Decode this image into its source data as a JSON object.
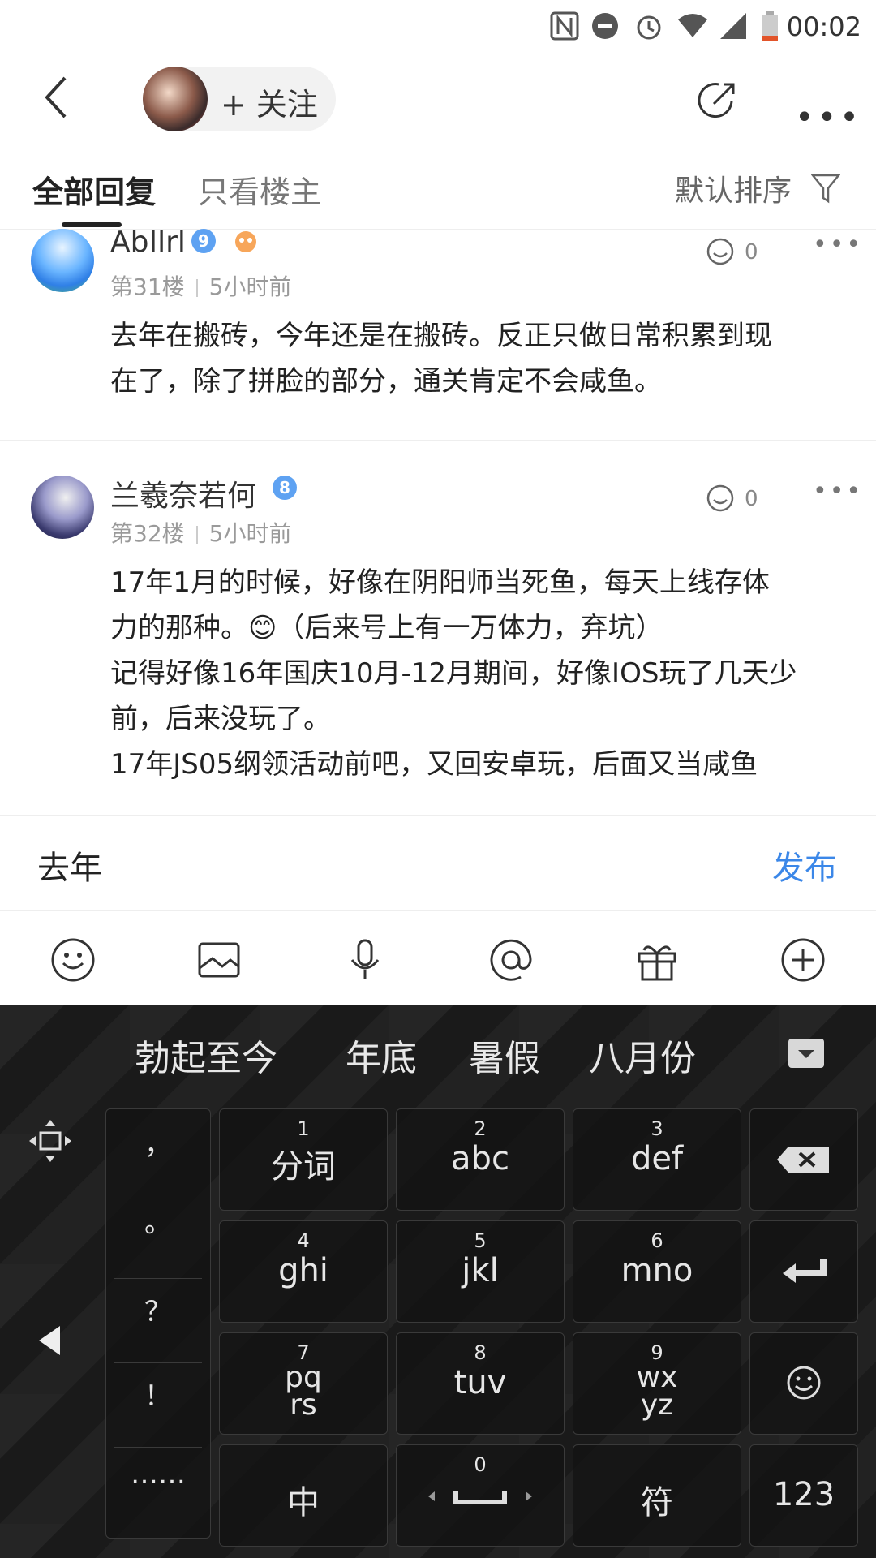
{
  "status_bar": {
    "time": "00:02"
  },
  "header": {
    "follow_label": "+ 关注"
  },
  "tabs": {
    "all": "全部回复",
    "owner_only": "只看楼主",
    "sort": "默认排序"
  },
  "posts": [
    {
      "username": "AbIlrl",
      "level": "9",
      "floor": "第31楼",
      "time": "5小时前",
      "likes": "0",
      "content_lines": [
        "去年在搬砖，今年还是在搬砖。反正只做日常积累到现",
        "在了，除了拼脸的部分，通关肯定不会咸鱼。"
      ]
    },
    {
      "username": "兰羲奈若何",
      "level": "8",
      "floor": "第32楼",
      "time": "5小时前",
      "likes": "0",
      "content_lines": [
        "17年1月的时候，好像在阴阳师当死鱼，每天上线存体",
        "力的那种。😊（后来号上有一万体力，弃坑）",
        "记得好像16年国庆10月-12月期间，好像IOS玩了几天少",
        "前，后来没玩了。",
        "17年JS05纲领活动前吧，又回安卓玩，后面又当咸鱼"
      ]
    }
  ],
  "input": {
    "value": "去年",
    "publish_label": "发布"
  },
  "toolbar": {
    "icons": [
      "emoji-icon",
      "image-icon",
      "mic-icon",
      "at-icon",
      "gift-icon",
      "plus-icon"
    ]
  },
  "keyboard": {
    "candidates": [
      "勃起至今",
      "年底",
      "暑假",
      "八月份"
    ],
    "punctuation": [
      "，",
      "。",
      "？",
      "！",
      "……"
    ],
    "keys": [
      {
        "num": "1",
        "label": "分词"
      },
      {
        "num": "2",
        "label": "abc"
      },
      {
        "num": "3",
        "label": "def"
      },
      {
        "num": "4",
        "label": "ghi"
      },
      {
        "num": "5",
        "label": "jkl"
      },
      {
        "num": "6",
        "label": "mno"
      },
      {
        "num": "7",
        "label": "pqrs"
      },
      {
        "num": "8",
        "label": "tuv"
      },
      {
        "num": "9",
        "label": "wxyz"
      }
    ],
    "bottom_row": {
      "zh": "中",
      "space_num": "0",
      "symbols": "符",
      "numbers": "123"
    }
  }
}
